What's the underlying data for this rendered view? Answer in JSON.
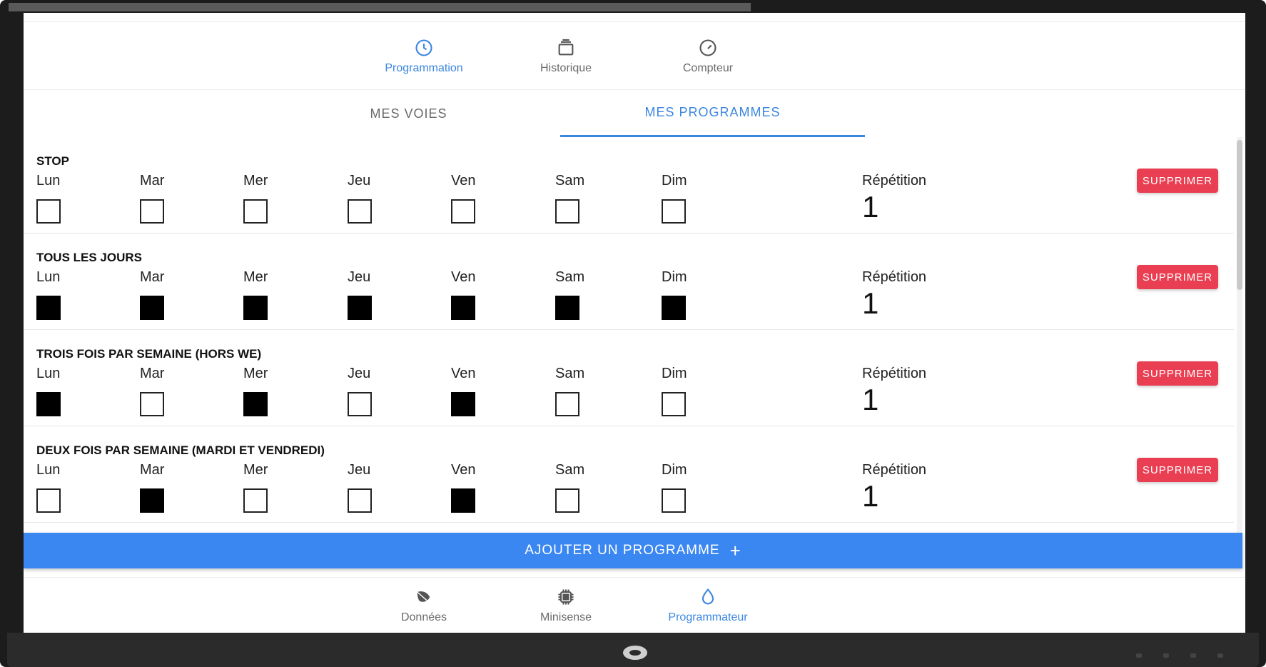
{
  "top_nav": [
    {
      "label": "Programmation",
      "icon": "clock-icon",
      "active": true
    },
    {
      "label": "Historique",
      "icon": "archive-icon",
      "active": false
    },
    {
      "label": "Compteur",
      "icon": "gauge-icon",
      "active": false
    }
  ],
  "sub_tabs": [
    {
      "label": "MES VOIES",
      "active": false
    },
    {
      "label": "MES PROGRAMMES",
      "active": true
    }
  ],
  "days": [
    "Lun",
    "Mar",
    "Mer",
    "Jeu",
    "Ven",
    "Sam",
    "Dim"
  ],
  "repetition_label": "Répétition",
  "delete_label": "SUPPRIMER",
  "programs": [
    {
      "name": "STOP",
      "checked": [
        false,
        false,
        false,
        false,
        false,
        false,
        false
      ],
      "repetition": "1"
    },
    {
      "name": "TOUS LES JOURS",
      "checked": [
        true,
        true,
        true,
        true,
        true,
        true,
        true
      ],
      "repetition": "1"
    },
    {
      "name": "TROIS FOIS PAR SEMAINE (HORS WE)",
      "checked": [
        true,
        false,
        true,
        false,
        true,
        false,
        false
      ],
      "repetition": "1"
    },
    {
      "name": "DEUX FOIS PAR SEMAINE (MARDI ET VENDREDI)",
      "checked": [
        false,
        true,
        false,
        false,
        true,
        false,
        false
      ],
      "repetition": "1"
    }
  ],
  "add_button": {
    "label": "AJOUTER UN PROGRAMME",
    "icon": "plus-icon",
    "symbol": "+"
  },
  "bottom_nav": [
    {
      "label": "Données",
      "icon": "leaf-icon",
      "active": false
    },
    {
      "label": "Minisense",
      "icon": "chip-icon",
      "active": false
    },
    {
      "label": "Programmateur",
      "icon": "drop-icon",
      "active": true
    }
  ],
  "colors": {
    "accent": "#3c86e0",
    "add_button": "#3a87f2",
    "delete_button": "#ea3f52"
  }
}
